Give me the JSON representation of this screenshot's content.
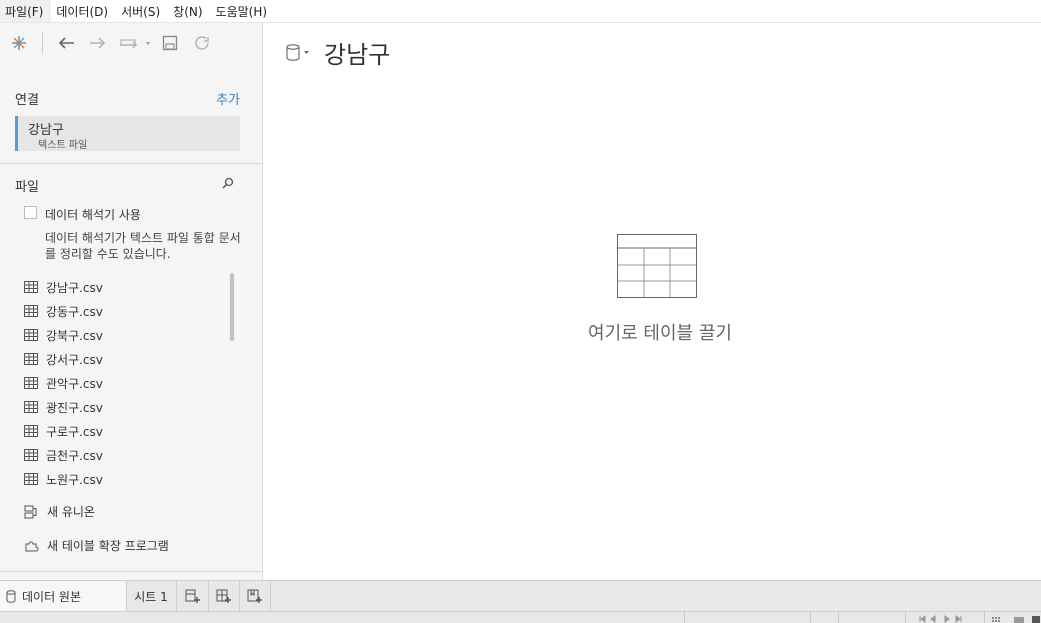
{
  "menu": [
    "파일(F)",
    "데이터(D)",
    "서버(S)",
    "창(N)",
    "도움말(H)"
  ],
  "connections": {
    "title": "연결",
    "add_label": "추가",
    "items": [
      {
        "name": "강남구",
        "type": "텍스트 파일"
      }
    ]
  },
  "files": {
    "title": "파일",
    "interpreter_label": "데이터 해석기 사용",
    "interpreter_desc": "데이터 해석기가 텍스트 파일 통합 문서를 정리할 수도 있습니다.",
    "items": [
      "강남구.csv",
      "강동구.csv",
      "강북구.csv",
      "강서구.csv",
      "관악구.csv",
      "광진구.csv",
      "구로구.csv",
      "금천구.csv",
      "노원구.csv"
    ],
    "new_union": "새 유니온",
    "new_extension": "새 테이블 확장 프로그램"
  },
  "main": {
    "datasource_title": "강남구",
    "drop_text": "여기로 테이블 끌기"
  },
  "tabs": {
    "data_source": "데이터 원본",
    "sheet": "시트 1"
  },
  "colors": {
    "accent": "#5b9bd5",
    "link": "#3d7fb8",
    "panel": "#f5f5f5"
  },
  "icons": [
    "tableau-logo-icon",
    "undo-icon",
    "redo-icon",
    "pause-updates-icon",
    "save-icon",
    "refresh-icon",
    "datasource-icon",
    "search-icon",
    "table-icon",
    "union-icon",
    "extension-icon",
    "new-worksheet-icon",
    "new-dashboard-icon",
    "new-story-icon"
  ]
}
